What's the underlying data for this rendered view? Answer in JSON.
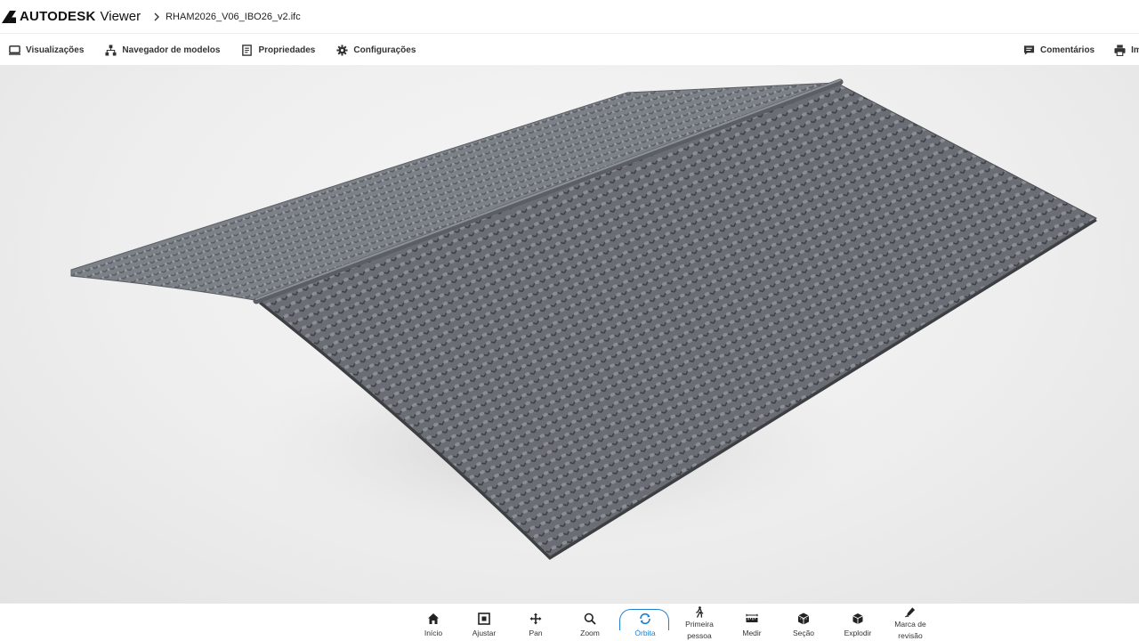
{
  "app": {
    "brand": "AUTODESK",
    "product": "Viewer",
    "breadcrumb_separator_icon": "chevron-right-icon",
    "file_name": "RHAM2026_V06_IBO26_v2.ifc"
  },
  "toolbar": {
    "left": [
      {
        "label": "Visualizações",
        "icon": "monitor-icon"
      },
      {
        "label": "Navegador de modelos",
        "icon": "hierarchy-icon"
      },
      {
        "label": "Propriedades",
        "icon": "properties-icon"
      },
      {
        "label": "Configurações",
        "icon": "gear-icon"
      }
    ],
    "right": [
      {
        "label": "Comentários",
        "icon": "comment-icon"
      },
      {
        "label": "Imp",
        "icon": "print-icon"
      }
    ]
  },
  "viewport": {
    "model": "roof-tiles",
    "background_color": "#eeeeee",
    "tile_color": "#6b6e74"
  },
  "bottom_toolbar": {
    "active": "Órbita",
    "accent_color": "#1f7fd1",
    "items": [
      {
        "label": "Início",
        "icon": "home-icon"
      },
      {
        "label": "Ajustar",
        "icon": "fit-icon"
      },
      {
        "label": "Pan",
        "icon": "pan-icon"
      },
      {
        "label": "Zoom",
        "icon": "zoom-icon"
      },
      {
        "label": "Órbita",
        "icon": "orbit-icon"
      },
      {
        "label": "Primeira pessoa",
        "icon": "walk-icon"
      },
      {
        "label": "Medir",
        "icon": "measure-icon"
      },
      {
        "label": "Seção",
        "icon": "section-icon"
      },
      {
        "label": "Explodir",
        "icon": "explode-icon"
      },
      {
        "label": "Marca de revisão",
        "icon": "markup-icon"
      }
    ]
  }
}
